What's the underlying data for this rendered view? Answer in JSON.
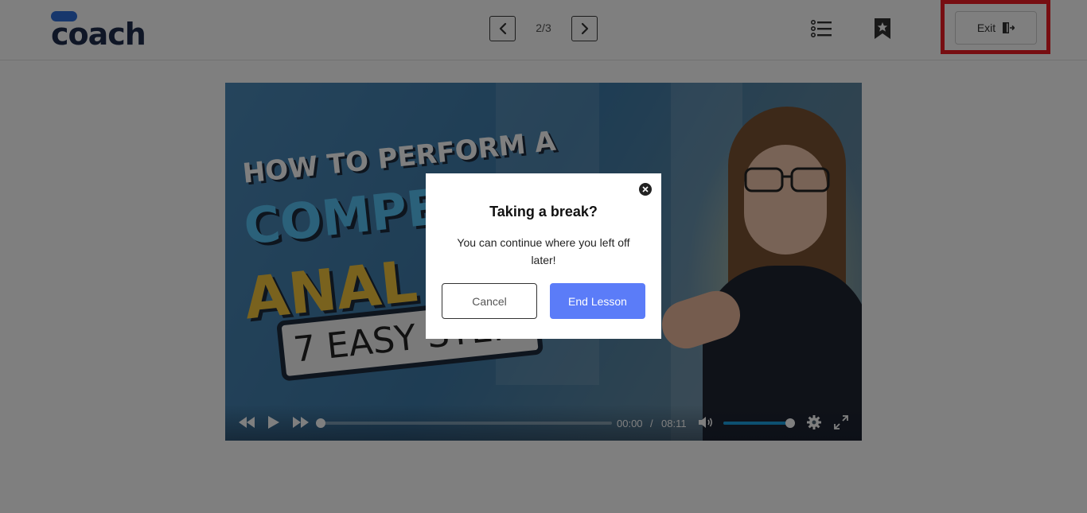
{
  "header": {
    "logo_text": "coach",
    "page_indicator": "2/3",
    "exit_label": "Exit"
  },
  "video": {
    "thumbnail": {
      "line1": "HOW TO PERFORM A",
      "line2": "COMPET",
      "line3": "ANAL",
      "line4": "7 EASY STEPS"
    },
    "time_current": "00:00",
    "time_separator": "/",
    "time_total": "08:11",
    "progress_fraction": 0.0,
    "volume_fraction": 1.0
  },
  "modal": {
    "title": "Taking a break?",
    "message": "You can continue where you left off later!",
    "cancel_label": "Cancel",
    "end_label": "End Lesson"
  },
  "icons": {
    "prev": "chevron-left-icon",
    "next": "chevron-right-icon",
    "toc": "list-icon",
    "bookmark": "bookmark-star-icon",
    "exit": "exit-door-icon",
    "close": "close-icon",
    "rewind": "rewind-icon",
    "play": "play-icon",
    "ffwd": "fast-forward-icon",
    "volume": "volume-icon",
    "settings": "gear-icon",
    "fullscreen": "fullscreen-icon"
  },
  "colors": {
    "highlight": "#ee1c25",
    "primary_button": "#5b7cf8",
    "logo": "#1f2d4d",
    "logo_accent": "#2f6fd8",
    "volume_fill": "#1aa1e2"
  }
}
